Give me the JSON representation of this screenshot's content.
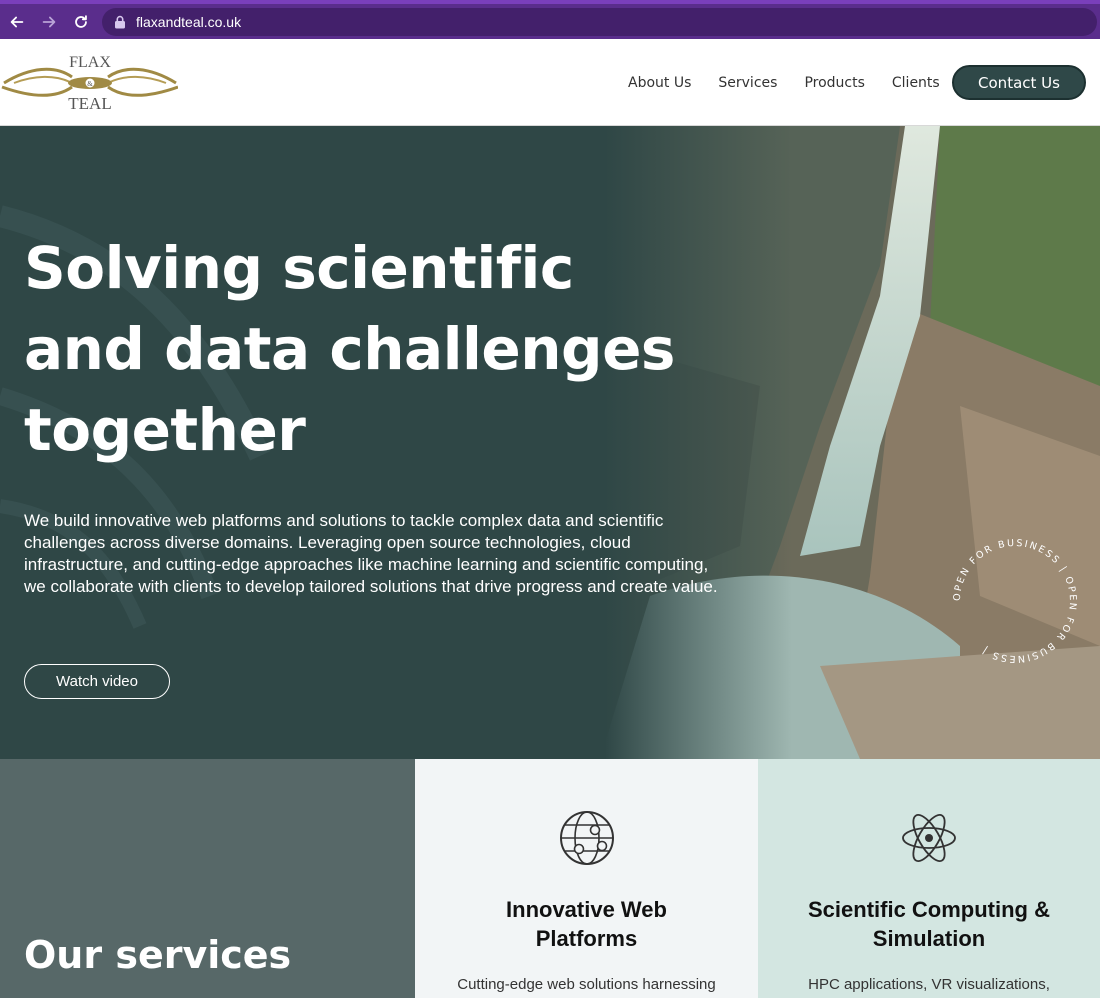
{
  "browser": {
    "url": "flaxandteal.co.uk",
    "chrome_color": "#5a2d8c"
  },
  "header": {
    "logo_text_top": "FLAX",
    "logo_text_mid": "&",
    "logo_text_bottom": "TEAL",
    "nav": [
      "About Us",
      "Services",
      "Products",
      "Clients"
    ],
    "contact": "Contact Us"
  },
  "hero": {
    "title_lines": [
      "Solving scientific",
      "and data challenges",
      "together"
    ],
    "description": "We build innovative web platforms and solutions to tackle complex data and scientific challenges across diverse domains. Leveraging open source technologies, cloud infrastructure, and cutting-edge approaches like machine learning and scientific computing, we collaborate with clients to develop tailored solutions that drive progress and create value.",
    "watch_video": "Watch video",
    "badge_text": "OPEN FOR BUSINESS | OPEN FOR BUSINESS | "
  },
  "services": {
    "title": "Our services",
    "cards": [
      {
        "icon": "globe-network-icon",
        "title_lines": [
          "Innovative Web",
          "Platforms"
        ],
        "text": "Cutting-edge web solutions harnessing"
      },
      {
        "icon": "atom-icon",
        "title_lines": [
          "Scientific Computing &",
          "Simulation"
        ],
        "text": "HPC applications, VR visualizations,"
      }
    ]
  },
  "colors": {
    "brand_dark": "#2f4848",
    "services_left": "#576868",
    "card_light": "#f2f5f6",
    "card_mint": "#d3e6e1"
  }
}
